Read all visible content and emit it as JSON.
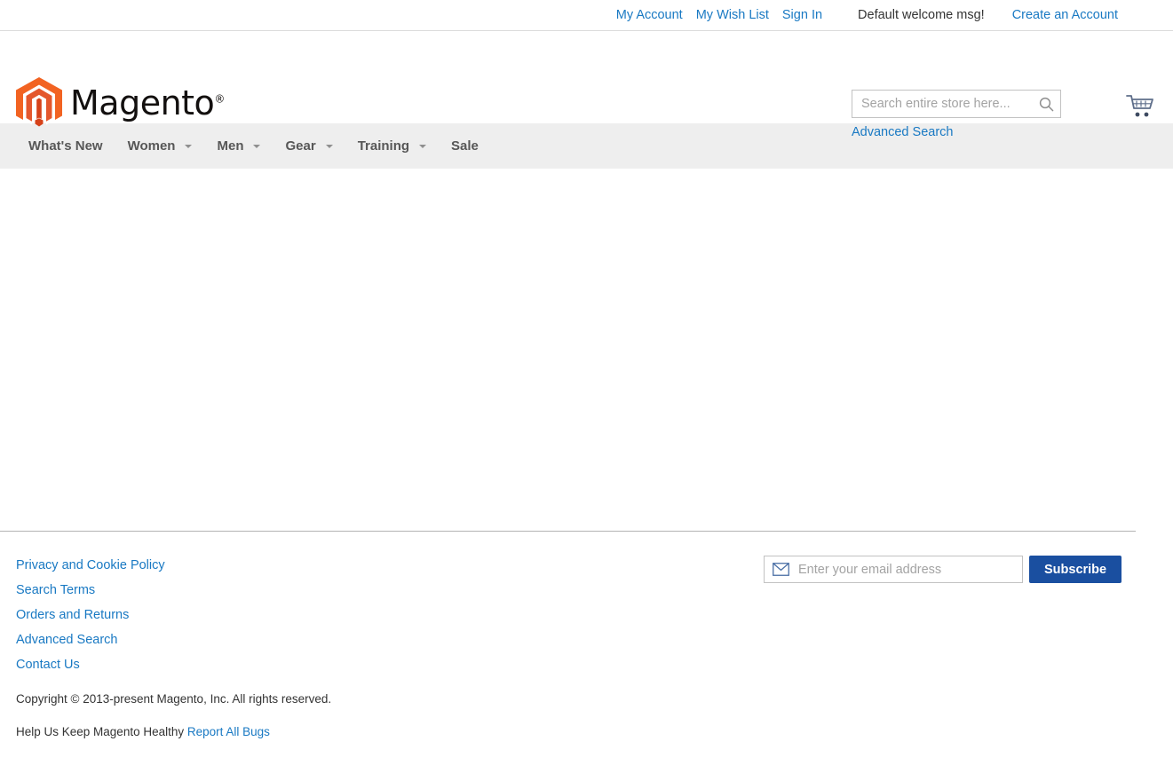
{
  "top_panel": {
    "links": [
      {
        "label": "My Account",
        "name": "my-account-link"
      },
      {
        "label": "My Wish List",
        "name": "my-wish-list-link"
      },
      {
        "label": "Sign In",
        "name": "sign-in-link"
      }
    ],
    "welcome_message": "Default welcome msg!",
    "create_account_label": "Create an Account"
  },
  "header": {
    "logo_text": "Magento",
    "logo_registered": "®",
    "search": {
      "placeholder": "Search entire store here...",
      "value": "",
      "icon": "search-icon"
    },
    "advanced_search_label": "Advanced Search",
    "cart_icon": "shopping-cart-icon"
  },
  "nav": {
    "items": [
      {
        "label": "What's New",
        "has_caret": false
      },
      {
        "label": "Women",
        "has_caret": true
      },
      {
        "label": "Men",
        "has_caret": true
      },
      {
        "label": "Gear",
        "has_caret": true
      },
      {
        "label": "Training",
        "has_caret": true
      },
      {
        "label": "Sale",
        "has_caret": false
      }
    ]
  },
  "footer": {
    "links": [
      "Privacy and Cookie Policy",
      "Search Terms",
      "Orders and Returns",
      "Advanced Search",
      "Contact Us"
    ],
    "newsletter": {
      "placeholder": "Enter your email address",
      "value": "",
      "icon": "envelope-icon",
      "subscribe_label": "Subscribe"
    },
    "copyright": "Copyright © 2013-present Magento, Inc. All rights reserved.",
    "bugs_text": "Help Us Keep Magento Healthy",
    "bugs_link_label": "Report All Bugs"
  },
  "colors": {
    "link": "#1979c3",
    "brand_orange": "#f26322",
    "brand_orange_dark": "#d6421a",
    "nav_bg": "#eeeeee",
    "subscribe_bg": "#1a4fa0"
  }
}
